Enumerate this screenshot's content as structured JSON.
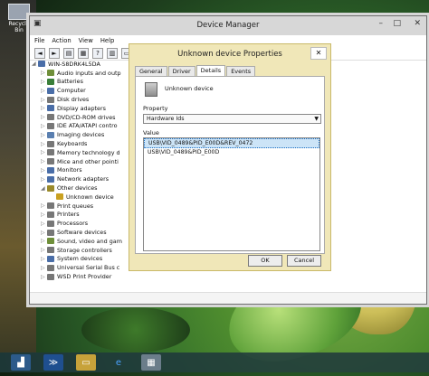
{
  "desktop": {
    "icon_label": "Recycle Bin"
  },
  "dm": {
    "title": "Device Manager",
    "menu": [
      "File",
      "Action",
      "View",
      "Help"
    ],
    "tree": [
      {
        "label": "WIN-S8DRK4L5DA",
        "level": 0,
        "color": "#4a6ea8"
      },
      {
        "label": "Audio inputs and outp",
        "level": 1,
        "color": "#6f8f3a"
      },
      {
        "label": "Batteries",
        "level": 1,
        "color": "#3a7f3a"
      },
      {
        "label": "Computer",
        "level": 1,
        "color": "#4a6ea8"
      },
      {
        "label": "Disk drives",
        "level": 1,
        "color": "#777"
      },
      {
        "label": "Display adapters",
        "level": 1,
        "color": "#4a6ea8"
      },
      {
        "label": "DVD/CD-ROM drives",
        "level": 1,
        "color": "#777"
      },
      {
        "label": "IDE ATA/ATAPI contro",
        "level": 1,
        "color": "#777"
      },
      {
        "label": "Imaging devices",
        "level": 1,
        "color": "#5a7fb0"
      },
      {
        "label": "Keyboards",
        "level": 1,
        "color": "#777"
      },
      {
        "label": "Memory technology d",
        "level": 1,
        "color": "#777"
      },
      {
        "label": "Mice and other pointi",
        "level": 1,
        "color": "#777"
      },
      {
        "label": "Monitors",
        "level": 1,
        "color": "#4a6ea8"
      },
      {
        "label": "Network adapters",
        "level": 1,
        "color": "#4a6ea8"
      },
      {
        "label": "Other devices",
        "level": 1,
        "color": "#9a8a2a"
      },
      {
        "label": "Unknown device",
        "level": 2,
        "color": "#c9a020"
      },
      {
        "label": "Print queues",
        "level": 1,
        "color": "#777"
      },
      {
        "label": "Printers",
        "level": 1,
        "color": "#777"
      },
      {
        "label": "Processors",
        "level": 1,
        "color": "#777"
      },
      {
        "label": "Software devices",
        "level": 1,
        "color": "#777"
      },
      {
        "label": "Sound, video and gam",
        "level": 1,
        "color": "#6f8f3a"
      },
      {
        "label": "Storage controllers",
        "level": 1,
        "color": "#777"
      },
      {
        "label": "System devices",
        "level": 1,
        "color": "#4a6ea8"
      },
      {
        "label": "Universal Serial Bus c",
        "level": 1,
        "color": "#777"
      },
      {
        "label": "WSD Print Provider",
        "level": 1,
        "color": "#777"
      }
    ]
  },
  "dialog": {
    "title": "Unknown device Properties",
    "close_glyph": "✕",
    "tabs": [
      "General",
      "Driver",
      "Details",
      "Events"
    ],
    "active_tab": "Details",
    "device_name": "Unknown device",
    "property_label": "Property",
    "property_value": "Hardware Ids",
    "value_label": "Value",
    "values": [
      "USB\\VID_0489&PID_E00D&REV_0472",
      "USB\\VID_0489&PID_E00D"
    ],
    "ok_label": "OK",
    "cancel_label": "Cancel"
  }
}
